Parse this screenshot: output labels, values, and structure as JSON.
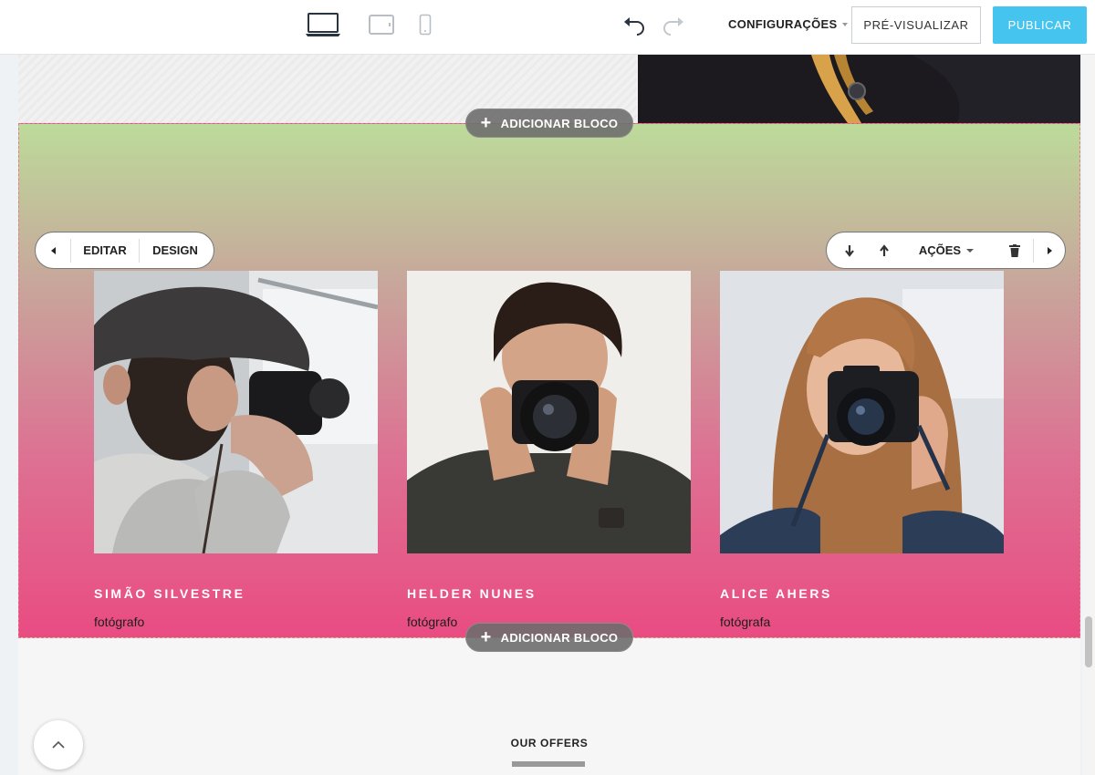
{
  "toolbar": {
    "devices": [
      "desktop-icon",
      "tablet-icon",
      "mobile-icon"
    ],
    "settings_label": "CONFIGURAÇÕES",
    "preview_label": "PRÉ-VISUALIZAR",
    "publish_label": "PUBLICAR",
    "publish_color": "#45c4f0"
  },
  "block_toolbar": {
    "edit_label": "EDITAR",
    "design_label": "DESIGN",
    "actions_label": "AÇÕES"
  },
  "add_block_label": "ADICIONAR BLOCO",
  "team": {
    "gradient": [
      "#bcdb9a",
      "#e94c82"
    ],
    "members": [
      {
        "name": "SIMÃO SILVESTRE",
        "role": "fotógrafo"
      },
      {
        "name": "HELDER NUNES",
        "role": "fotógrafo"
      },
      {
        "name": "ALICE AHERS",
        "role": "fotógrafa"
      }
    ]
  },
  "next_section": {
    "title": "OUR OFFERS"
  }
}
